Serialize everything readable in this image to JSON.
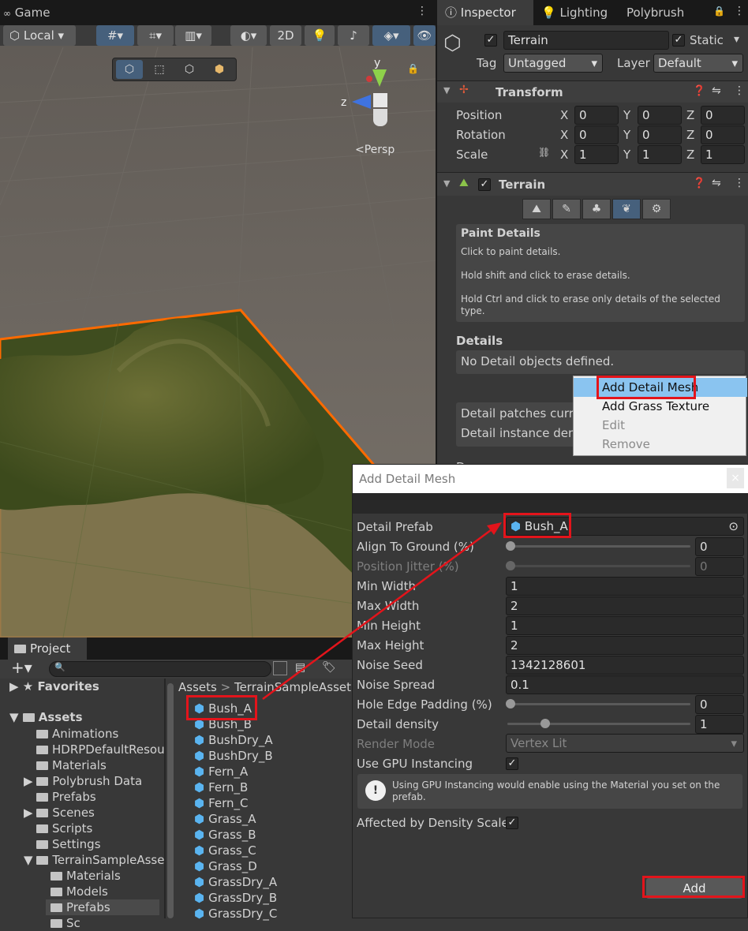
{
  "scene": {
    "tab_label": "Game",
    "local_label": "Local",
    "btn_2d": "2D",
    "gizmo": {
      "y": "y",
      "z": "z",
      "persp": "<Persp"
    }
  },
  "inspector": {
    "tabs": [
      "Inspector",
      "Lighting",
      "Polybrush"
    ],
    "object_name": "Terrain",
    "static_label": "Static",
    "tag_label": "Tag",
    "tag_value": "Untagged",
    "layer_label": "Layer",
    "layer_value": "Default",
    "transform": {
      "title": "Transform",
      "rows": [
        {
          "label": "Position",
          "x": "0",
          "y": "0",
          "z": "0"
        },
        {
          "label": "Rotation",
          "x": "0",
          "y": "0",
          "z": "0"
        },
        {
          "label": "Scale",
          "x": "1",
          "y": "1",
          "z": "1"
        }
      ],
      "axis": [
        "X",
        "Y",
        "Z"
      ]
    },
    "terrain": {
      "title": "Terrain",
      "paint_title": "Paint Details",
      "paint_lines": [
        "Click to paint details.",
        "Hold shift and click to erase details.",
        "Hold Ctrl and click to erase only details of the selected",
        "type."
      ],
      "details_title": "Details",
      "details_empty": "No Detail objects defined.",
      "patches_label": "Detail patches curre",
      "instance_label": "Detail instance dens",
      "cut_label": "D"
    },
    "context_menu": [
      "Add Detail Mesh",
      "Add Grass Texture",
      "Edit",
      "Remove"
    ]
  },
  "dialog": {
    "title": "Add Detail Mesh",
    "close": "×",
    "rows": {
      "prefab_label": "Detail Prefab",
      "prefab_value": "Bush_A",
      "align_label": "Align To Ground (%)",
      "align_value": "0",
      "jitter_label": "Position Jitter (%)",
      "jitter_value": "0",
      "min_width_label": "Min Width",
      "min_width_value": "1",
      "max_width_label": "Max Width",
      "max_width_value": "2",
      "min_height_label": "Min Height",
      "min_height_value": "1",
      "max_height_label": "Max Height",
      "max_height_value": "2",
      "noise_seed_label": "Noise Seed",
      "noise_seed_value": "1342128601",
      "noise_spread_label": "Noise Spread",
      "noise_spread_value": "0.1",
      "hole_label": "Hole Edge Padding (%)",
      "hole_value": "0",
      "density_label": "Detail density",
      "density_value": "1",
      "render_label": "Render Mode",
      "render_value": "Vertex Lit",
      "gpu_label": "Use GPU Instancing",
      "gpu_info": "Using GPU Instancing would enable using the Material you set on the prefab.",
      "affected_label": "Affected by Density Scale"
    },
    "add_button": "Add"
  },
  "project": {
    "tab_label": "Project",
    "favorites": "Favorites",
    "assets": "Assets",
    "tree": [
      "Animations",
      "HDRPDefaultResou",
      "Materials",
      "Polybrush Data",
      "Prefabs",
      "Scenes",
      "Scripts",
      "Settings",
      "TerrainSampleAsse"
    ],
    "subtree": [
      "Materials",
      "Models",
      "Prefabs"
    ],
    "last_cut": "Sc",
    "breadcrumb": [
      "Assets",
      ">",
      "TerrainSampleAsset"
    ],
    "files": [
      "Bush_A",
      "Bush_B",
      "BushDry_A",
      "BushDry_B",
      "Fern_A",
      "Fern_B",
      "Fern_C",
      "Grass_A",
      "Grass_B",
      "Grass_C",
      "Grass_D",
      "GrassDry_A",
      "GrassDry_B",
      "GrassDry_C"
    ]
  },
  "colors": {
    "highlight": "#e3141b",
    "selection": "#8ac4f0",
    "terrain_outline": "#ff6a00"
  }
}
